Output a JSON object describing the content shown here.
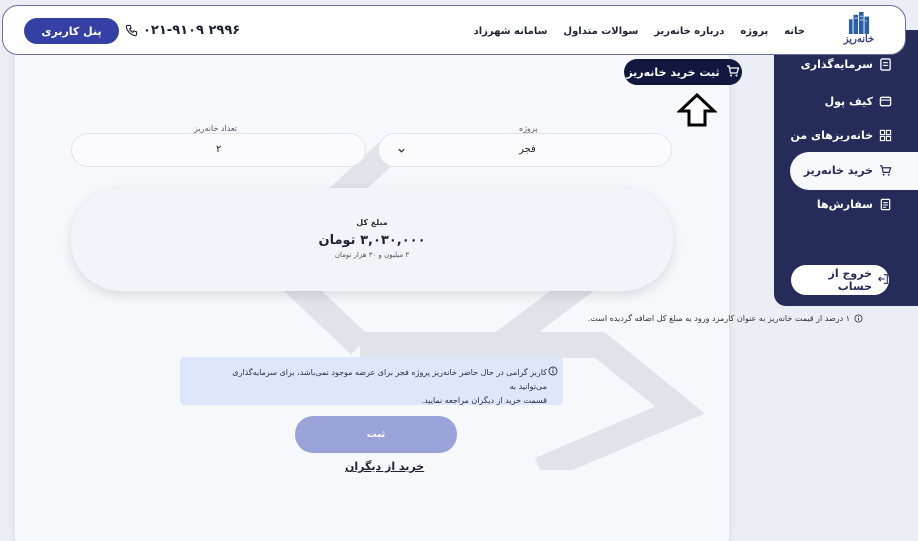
{
  "header": {
    "logo_text": "خانه‌ریز",
    "nav": [
      "خانه",
      "پروژه",
      "درباره خانه‌ریز",
      "سوالات متداول",
      "سامانه شهرزاد"
    ],
    "phone": "۰۲۱-۹۱۰۹ ۲۹۹۶",
    "panel_button": "پنل کاربری"
  },
  "sidebar": {
    "items": [
      {
        "label": "سرمایه‌گذاری",
        "icon": "invest-icon"
      },
      {
        "label": "کیف پول",
        "icon": "wallet-icon"
      },
      {
        "label": "خانه‌ریزهای من",
        "icon": "grid-icon"
      },
      {
        "label": "خرید خانه‌ریز",
        "icon": "cart-icon",
        "active": true
      },
      {
        "label": "سفارش‌ها",
        "icon": "orders-icon"
      }
    ],
    "logout": "خروج از حساب"
  },
  "main": {
    "buy_tag": "ثبت خرید خانه‌ریز",
    "project_label": "پروژه",
    "project_value": "فجر",
    "count_label": "تعداد خانه‌ریز",
    "count_value": "۲",
    "total_label": "مبلغ کل",
    "total_amount": "۳,۰۳۰,۰۰۰ تومان",
    "total_words": "۳ میلیون و ۳۰ هزار تومان",
    "fee_note": "۱ درصد از قیمت خانه‌ریز به عنوان کارمزد ورود به مبلغ کل اضافه گردیده است.",
    "alert_line1": "کاربر گرامی در حال حاضر خانه‌ریز پروژه فجر برای عرضه موجود نمی‌باشد، برای سرمایه‌گذاری می‌توانید به",
    "alert_line2": "قسمت خرید از دیگران مراجعه نمایید.",
    "submit": "ثبت",
    "buy_from_others": "خرید از دیگران"
  },
  "colors": {
    "primary": "#3440a4",
    "sidebar": "#252c59",
    "dark": "#12173f",
    "alert_bg": "#dde6fb",
    "submit_disabled": "#9aa3d9"
  }
}
